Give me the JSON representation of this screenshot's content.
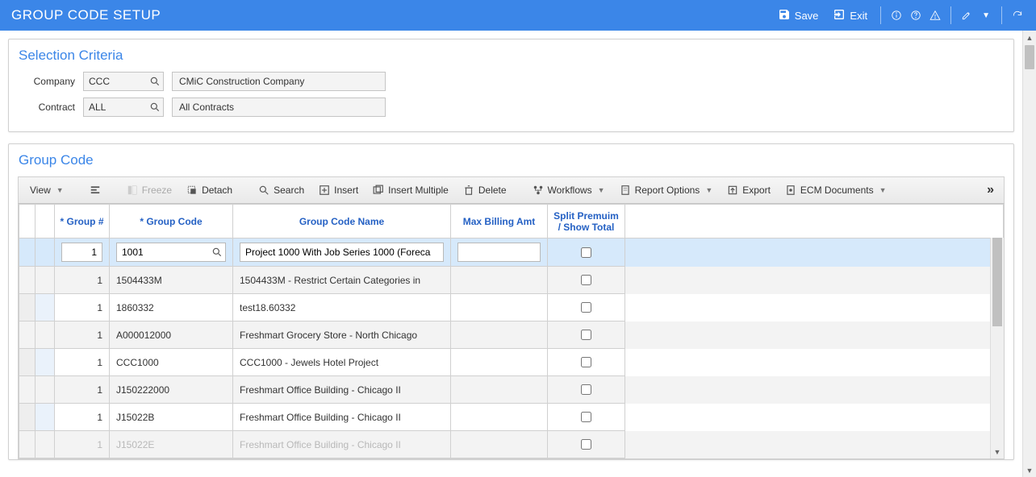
{
  "header": {
    "title": "GROUP CODE SETUP",
    "save": "Save",
    "exit": "Exit"
  },
  "selection": {
    "title": "Selection Criteria",
    "company_label": "Company",
    "company_value": "CCC",
    "company_name": "CMiC Construction Company",
    "contract_label": "Contract",
    "contract_value": "ALL",
    "contract_name": "All Contracts"
  },
  "group": {
    "title": "Group Code",
    "toolbar": {
      "view": "View",
      "freeze": "Freeze",
      "detach": "Detach",
      "search": "Search",
      "insert": "Insert",
      "insert_multiple": "Insert Multiple",
      "delete": "Delete",
      "workflows": "Workflows",
      "report_options": "Report Options",
      "export": "Export",
      "ecm_documents": "ECM Documents"
    },
    "columns": {
      "group_num": "* Group #",
      "group_code": "* Group Code",
      "name": "Group Code Name",
      "max_billing": "Max Billing Amt",
      "split": "Split Premuim / Show Total"
    },
    "rows": [
      {
        "num": "1",
        "code": "1001",
        "name": "Project 1000 With Job Series 1000 (Foreca",
        "max": "",
        "split": false,
        "selected": true,
        "editable": true
      },
      {
        "num": "1",
        "code": "1504433M",
        "name": "1504433M - Restrict Certain Categories in",
        "max": "",
        "split": false,
        "alt": true
      },
      {
        "num": "1",
        "code": "1860332",
        "name": "test18.60332",
        "max": "",
        "split": false
      },
      {
        "num": "1",
        "code": "A000012000",
        "name": "Freshmart Grocery Store -  North Chicago",
        "max": "",
        "split": false,
        "alt": true
      },
      {
        "num": "1",
        "code": "CCC1000",
        "name": "CCC1000 - Jewels Hotel Project",
        "max": "",
        "split": false
      },
      {
        "num": "1",
        "code": "J150222000",
        "name": "Freshmart Office Building - Chicago II",
        "max": "",
        "split": false,
        "alt": true
      },
      {
        "num": "1",
        "code": "J15022B",
        "name": "Freshmart Office Building - Chicago II",
        "max": "",
        "split": false
      },
      {
        "num": "1",
        "code": "J15022E",
        "name": "Freshmart Office Building - Chicago II",
        "max": "",
        "split": false,
        "faded": true
      }
    ]
  }
}
